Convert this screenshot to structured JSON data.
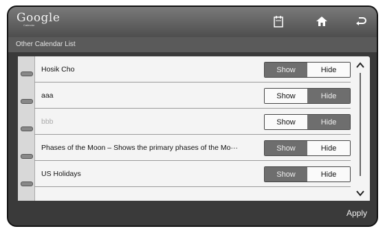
{
  "header": {
    "logo": "Google",
    "logo_sub": "Calendar",
    "icons": [
      "calendar-icon",
      "home-icon",
      "back-icon"
    ]
  },
  "subheader": {
    "title": "Other Calendar List"
  },
  "toggle_labels": {
    "show": "Show",
    "hide": "Hide"
  },
  "calendars": [
    {
      "name": "Hosik Cho",
      "state": "show",
      "muted": false
    },
    {
      "name": "aaa",
      "state": "hide",
      "muted": false
    },
    {
      "name": "bbb",
      "state": "hide",
      "muted": true
    },
    {
      "name": "Phases of the Moon – Shows the primary phases of the Mo···",
      "state": "show",
      "muted": false
    },
    {
      "name": "US Holidays",
      "state": "show",
      "muted": false
    }
  ],
  "footer": {
    "apply_label": "Apply"
  },
  "colors": {
    "selected": "#6e6e6e",
    "unselected": "#fafafa",
    "topbar": "#5a5a5a"
  }
}
